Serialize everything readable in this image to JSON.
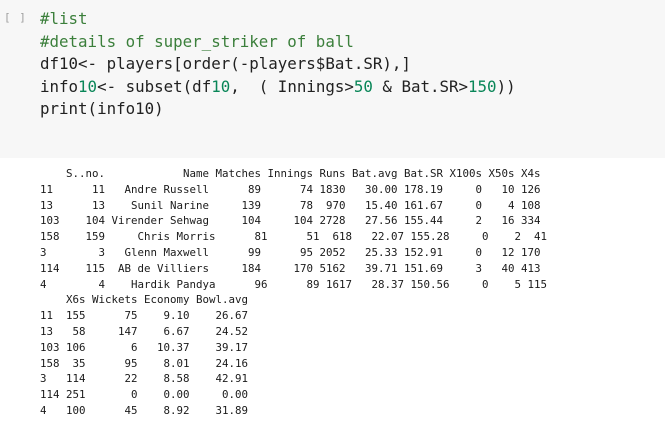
{
  "cell": {
    "prompt": "[ ]",
    "code_lines": [
      "#list",
      "#details of super_striker of ball",
      "df10<- players[order(-players$Bat.SR),]",
      "info10<- subset(df10,  ( Innings>50 & Bat.SR>150))",
      "print(info10)"
    ]
  },
  "output": {
    "lines": [
      "    S..no.            Name Matches Innings Runs Bat.avg Bat.SR X100s X50s X4s",
      "11      11   Andre Russell      89      74 1830   30.00 178.19     0   10 126",
      "13      13    Sunil Narine     139      78  970   15.40 161.67     0    4 108",
      "103    104 Virender Sehwag     104     104 2728   27.56 155.44     2   16 334",
      "158    159     Chris Morris      81      51  618   22.07 155.28     0    2  41",
      "3        3   Glenn Maxwell      99      95 2052   25.33 152.91     0   12 170",
      "114    115  AB de Villiers     184     170 5162   39.71 151.69     3   40 413",
      "4        4    Hardik Pandya      96      89 1617   28.37 150.56     0    5 115",
      "    X6s Wickets Economy Bowl.avg",
      "11  155      75    9.10    26.67",
      "13   58     147    6.67    24.52",
      "103 106       6   10.37    39.17",
      "158  35      95    8.01    24.16",
      "3   114      22    8.58    42.91",
      "114 251       0    0.00     0.00",
      "4   100      45    8.92    31.89"
    ]
  }
}
